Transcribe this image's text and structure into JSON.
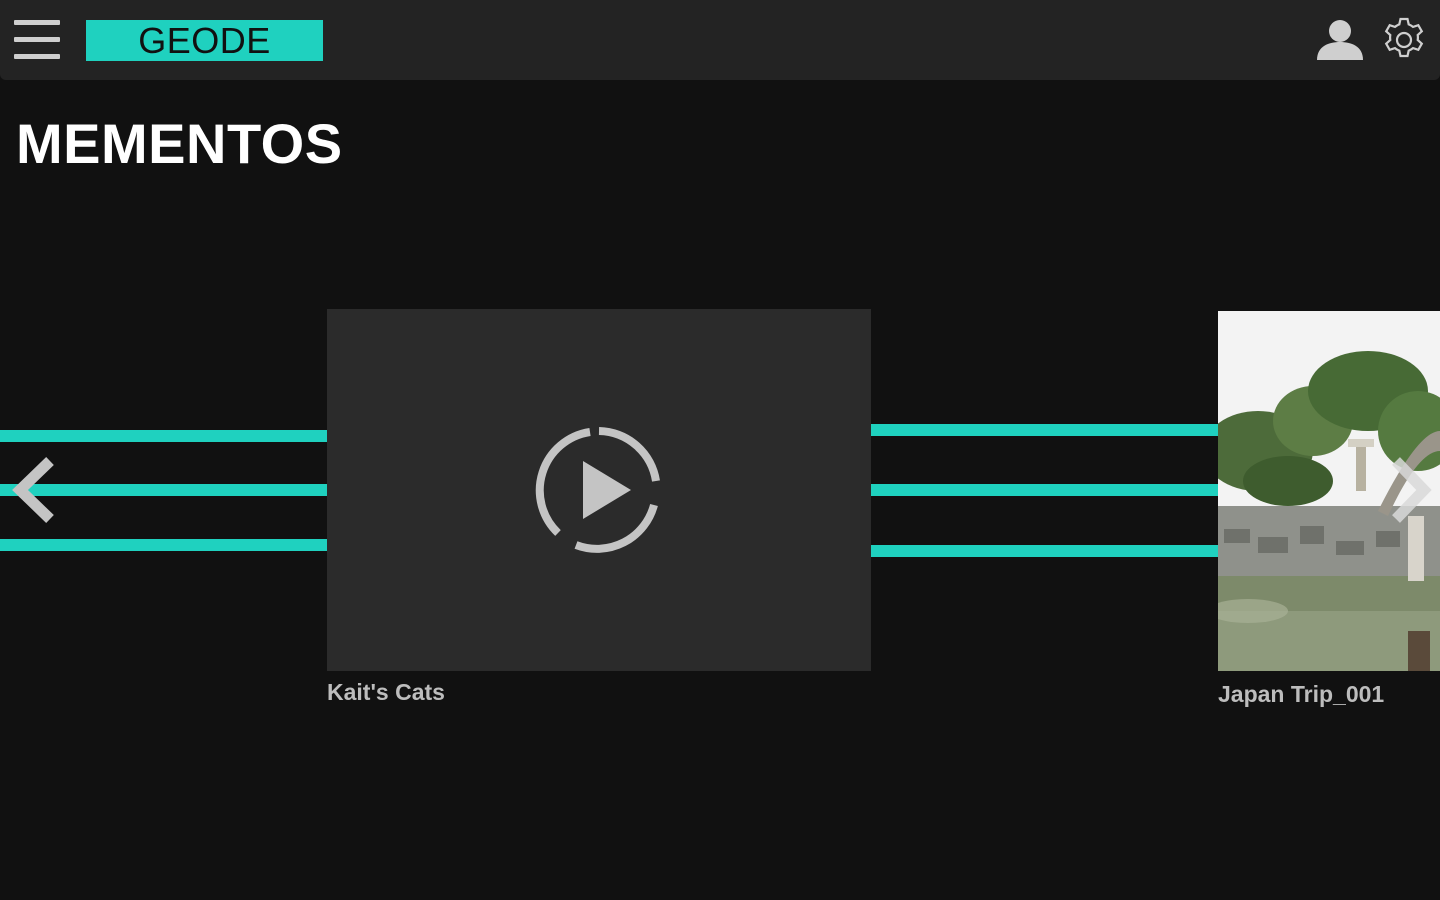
{
  "app": {
    "brand": "GEODE"
  },
  "header": {
    "menu_icon": "hamburger-menu-icon",
    "user_icon": "user-profile-icon",
    "settings_icon": "gear-icon"
  },
  "page": {
    "title": "MEMENTOS"
  },
  "carousel": {
    "accent_color": "#1fd1bf",
    "prev_icon": "chevron-left-icon",
    "next_icon": "chevron-right-icon",
    "items": [
      {
        "title": "Kait's Cats",
        "type": "video",
        "icon": "play-circle-icon"
      },
      {
        "title": "Japan Trip_001",
        "type": "photo",
        "icon": "photo-thumbnail"
      }
    ]
  },
  "colors": {
    "background": "#111111",
    "topbar": "#232323",
    "accent": "#1fd1bf",
    "card": "#2b2b2b",
    "caption": "#bdbdbd"
  }
}
